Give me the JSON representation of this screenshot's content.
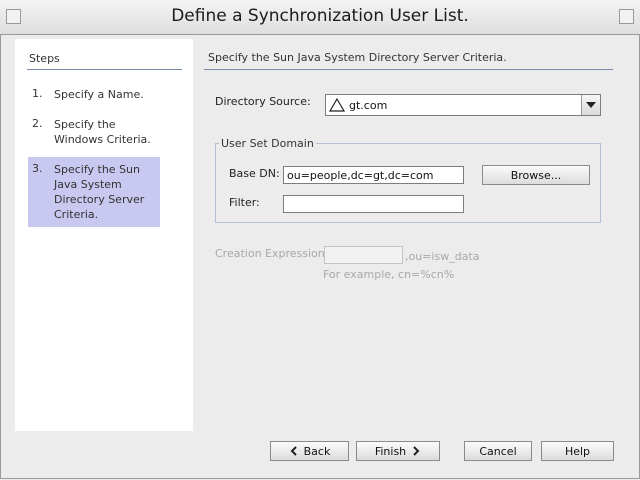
{
  "window": {
    "title": "Define a Synchronization User List."
  },
  "steps": {
    "heading": "Steps",
    "items": [
      {
        "num": "1.",
        "label": "Specify a Name."
      },
      {
        "num": "2.",
        "label": "Specify the Windows Criteria."
      },
      {
        "num": "3.",
        "label": "Specify the Sun Java System Directory Server Criteria."
      }
    ]
  },
  "main": {
    "heading": "Specify the Sun Java System Directory Server Criteria.",
    "directory_source": {
      "label": "Directory Source:",
      "value": "gt.com"
    },
    "user_set_domain": {
      "legend": "User Set Domain",
      "base_dn_label": "Base DN:",
      "base_dn_value": "ou=people,dc=gt,dc=com",
      "filter_label": "Filter:",
      "filter_value": "",
      "browse_label": "Browse..."
    },
    "creation_expression": {
      "label": "Creation Expression:",
      "value": "",
      "suffix": ",ou=isw_data",
      "example": "For example, cn=%cn%"
    }
  },
  "buttons": {
    "back": "Back",
    "finish": "Finish",
    "cancel": "Cancel",
    "help": "Help"
  }
}
